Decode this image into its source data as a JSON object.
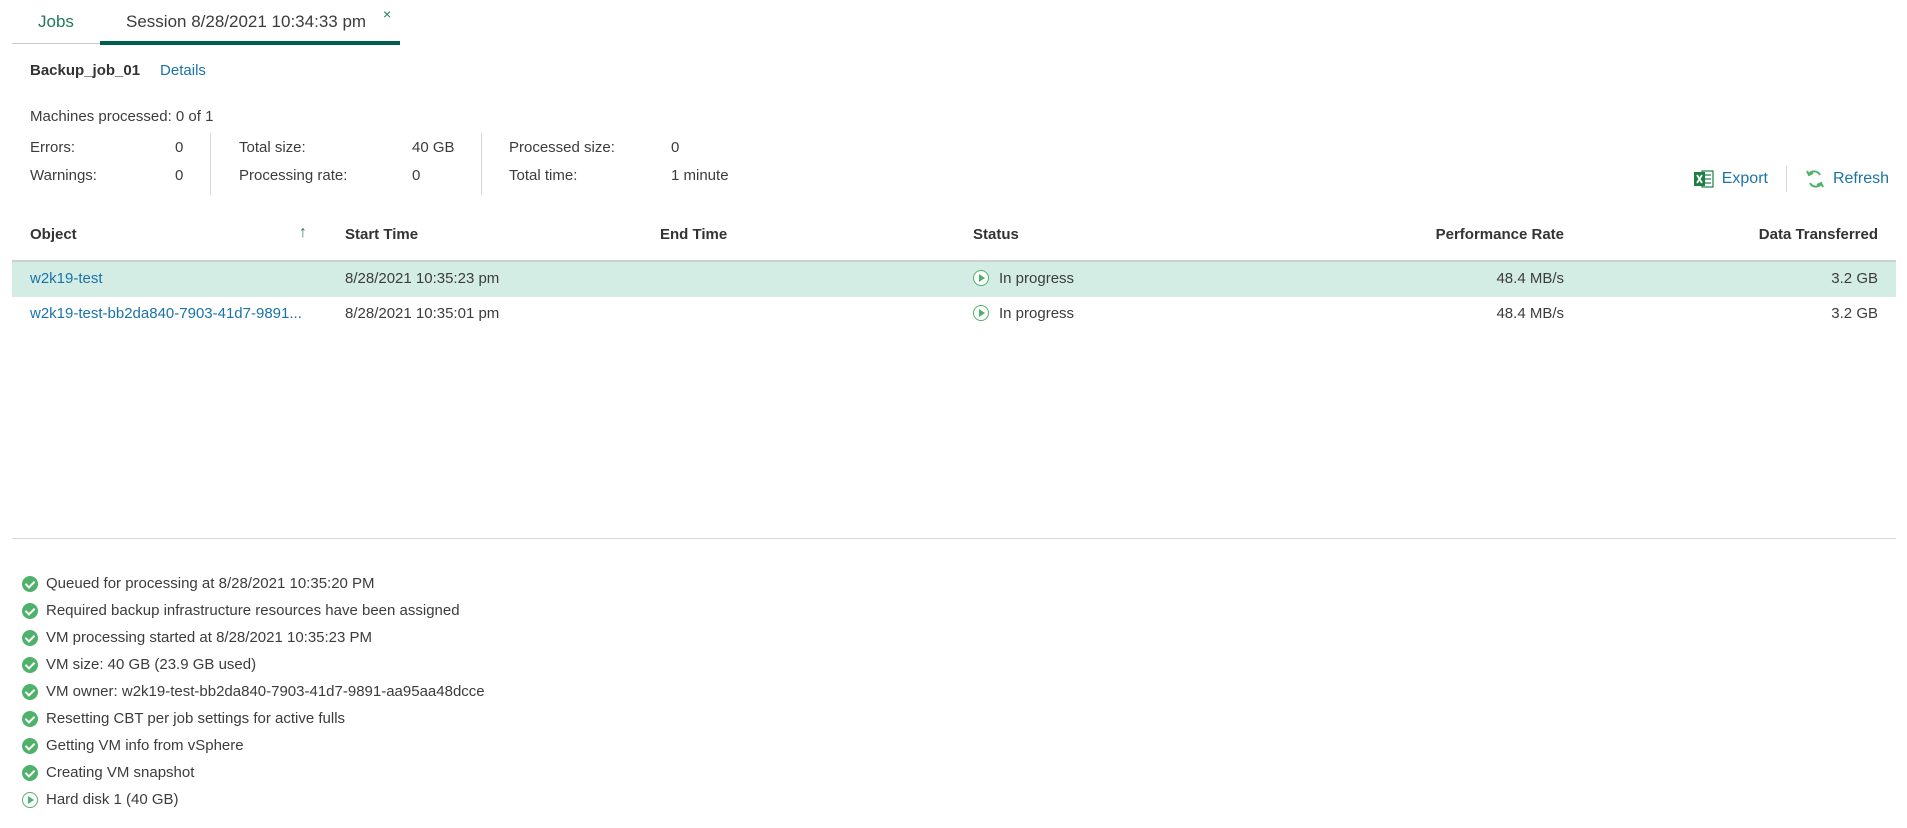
{
  "tabs": {
    "jobs_label": "Jobs",
    "session_label": "Session 8/28/2021 10:34:33 pm",
    "close_glyph": "×"
  },
  "header": {
    "job_name": "Backup_job_01",
    "details_label": "Details"
  },
  "summary": {
    "machines_processed": "Machines processed: 0 of 1",
    "errors_label": "Errors:",
    "errors_value": "0",
    "warnings_label": "Warnings:",
    "warnings_value": "0",
    "total_size_label": "Total size:",
    "total_size_value": "40 GB",
    "processing_rate_label": "Processing rate:",
    "processing_rate_value": "0",
    "processed_size_label": "Processed size:",
    "processed_size_value": "0",
    "total_time_label": "Total time:",
    "total_time_value": "1 minute"
  },
  "toolbar": {
    "export_label": "Export",
    "refresh_label": "Refresh"
  },
  "table": {
    "columns": {
      "object": "Object",
      "start_time": "Start Time",
      "end_time": "End Time",
      "status": "Status",
      "performance_rate": "Performance Rate",
      "data_transferred": "Data Transferred"
    },
    "sort_glyph": "↑",
    "rows": [
      {
        "object": "w2k19-test",
        "start_time": "8/28/2021 10:35:23 pm",
        "end_time": "",
        "status": "In progress",
        "performance_rate": "48.4 MB/s",
        "data_transferred": "3.2 GB"
      },
      {
        "object": "w2k19-test-bb2da840-7903-41d7-9891...",
        "start_time": "8/28/2021 10:35:01 pm",
        "end_time": "",
        "status": "In progress",
        "performance_rate": "48.4 MB/s",
        "data_transferred": "3.2 GB"
      }
    ]
  },
  "log": [
    {
      "text": "Queued for processing at 8/28/2021 10:35:20 PM",
      "state": "success"
    },
    {
      "text": "Required backup infrastructure resources have been assigned",
      "state": "success"
    },
    {
      "text": "VM processing started at 8/28/2021 10:35:23 PM",
      "state": "success"
    },
    {
      "text": "VM size: 40 GB (23.9 GB used)",
      "state": "success"
    },
    {
      "text": "VM owner: w2k19-test-bb2da840-7903-41d7-9891-aa95aa48dcce",
      "state": "success"
    },
    {
      "text": "Resetting CBT per job settings for active fulls",
      "state": "success"
    },
    {
      "text": "Getting VM info from vSphere",
      "state": "success"
    },
    {
      "text": "Creating VM snapshot",
      "state": "success"
    },
    {
      "text": "Hard disk 1 (40 GB)",
      "state": "in-progress"
    }
  ],
  "colors": {
    "accent": "#005f4b",
    "link": "#1a73a8",
    "success": "#4fb26a",
    "selected_row": "#d4ede4"
  }
}
